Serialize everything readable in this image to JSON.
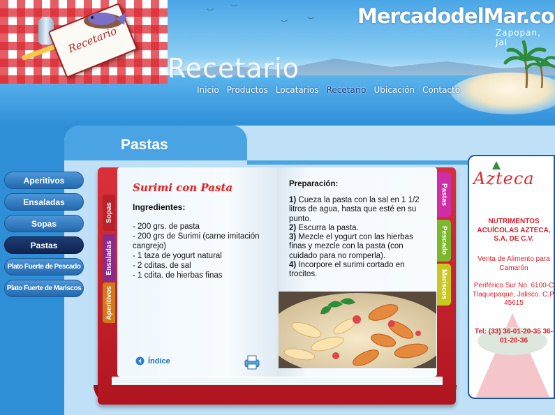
{
  "header": {
    "brand": "MercadodelMar.com",
    "brand_sub": "Zapopan, Jal",
    "section_title": "Recetario",
    "book_label": "Recetario",
    "nav": [
      "Inicio",
      "Productos",
      "Locatarios",
      "Recetario",
      "Ubicación",
      "Contacto"
    ],
    "nav_active": "Recetario"
  },
  "page": {
    "heading": "Pastas"
  },
  "sidebar": {
    "items": [
      {
        "label": "Aperitivos"
      },
      {
        "label": "Ensaladas"
      },
      {
        "label": "Sopas"
      },
      {
        "label": "Pastas"
      },
      {
        "label": "Plato Fuerte de Pescado"
      },
      {
        "label": "Plato Fuerte de Mariscos"
      }
    ],
    "active": "Pastas"
  },
  "book": {
    "left_tabs": [
      "Sopas",
      "Ensaladas",
      "Aperitivos"
    ],
    "right_tabs": [
      "Pastas",
      "Pescado",
      "Mariscos"
    ],
    "recipe_title": "Surimi con Pasta",
    "ingredients_heading": "Ingredientes:",
    "ingredients": [
      "- 200 grs. de pasta",
      "- 200 grs de Surimi (carne imitación cangrejo)",
      "- 1 taza de yogurt natural",
      "- 2 cditas. de sal",
      "- 1 cdita. de hierbas finas"
    ],
    "index_label": "Índice",
    "preparation_heading": "Preparación:",
    "steps": [
      {
        "num": "1)",
        "text": " Cueza la pasta con la sal en 1 1/2 litros de agua, hasta que esté en su punto."
      },
      {
        "num": "2)",
        "text": " Escurra la pasta."
      },
      {
        "num": "3)",
        "text": " Mezcle el yogurt con las hierbas finas y mezcle con la pasta (con cuidado para no romperla)."
      },
      {
        "num": "4)",
        "text": " Incorpore el surimi cortado en trocitos."
      }
    ]
  },
  "ad": {
    "logo": "Azteca",
    "company": "NUTRIMENTOS ACUÍCOLAS AZTECA, S.A. DE C.V.",
    "tagline": "Venta de Alimento para Camarón",
    "address": "Periférico Sur No. 6100-C Tlaquepaque, Jalisco. C.P. 45615",
    "phone": "Tel: (33) 36-01-20-35 36-01-20-36"
  },
  "colors": {
    "sky": "#4aa6e6",
    "band": "#bfe0f6",
    "sidebar_button": "#2268ad",
    "sidebar_active": "#0f2450",
    "book_cover": "#c41e28",
    "ad_text": "#d41f2a",
    "tab_pastas": "#d02ea8",
    "tab_pescado": "#7cb82f",
    "tab_mariscos": "#c8c81e",
    "tab_sopas": "#b8222a",
    "tab_ensaladas": "#8a2a8a",
    "tab_aperitivos": "#d07a1c"
  }
}
